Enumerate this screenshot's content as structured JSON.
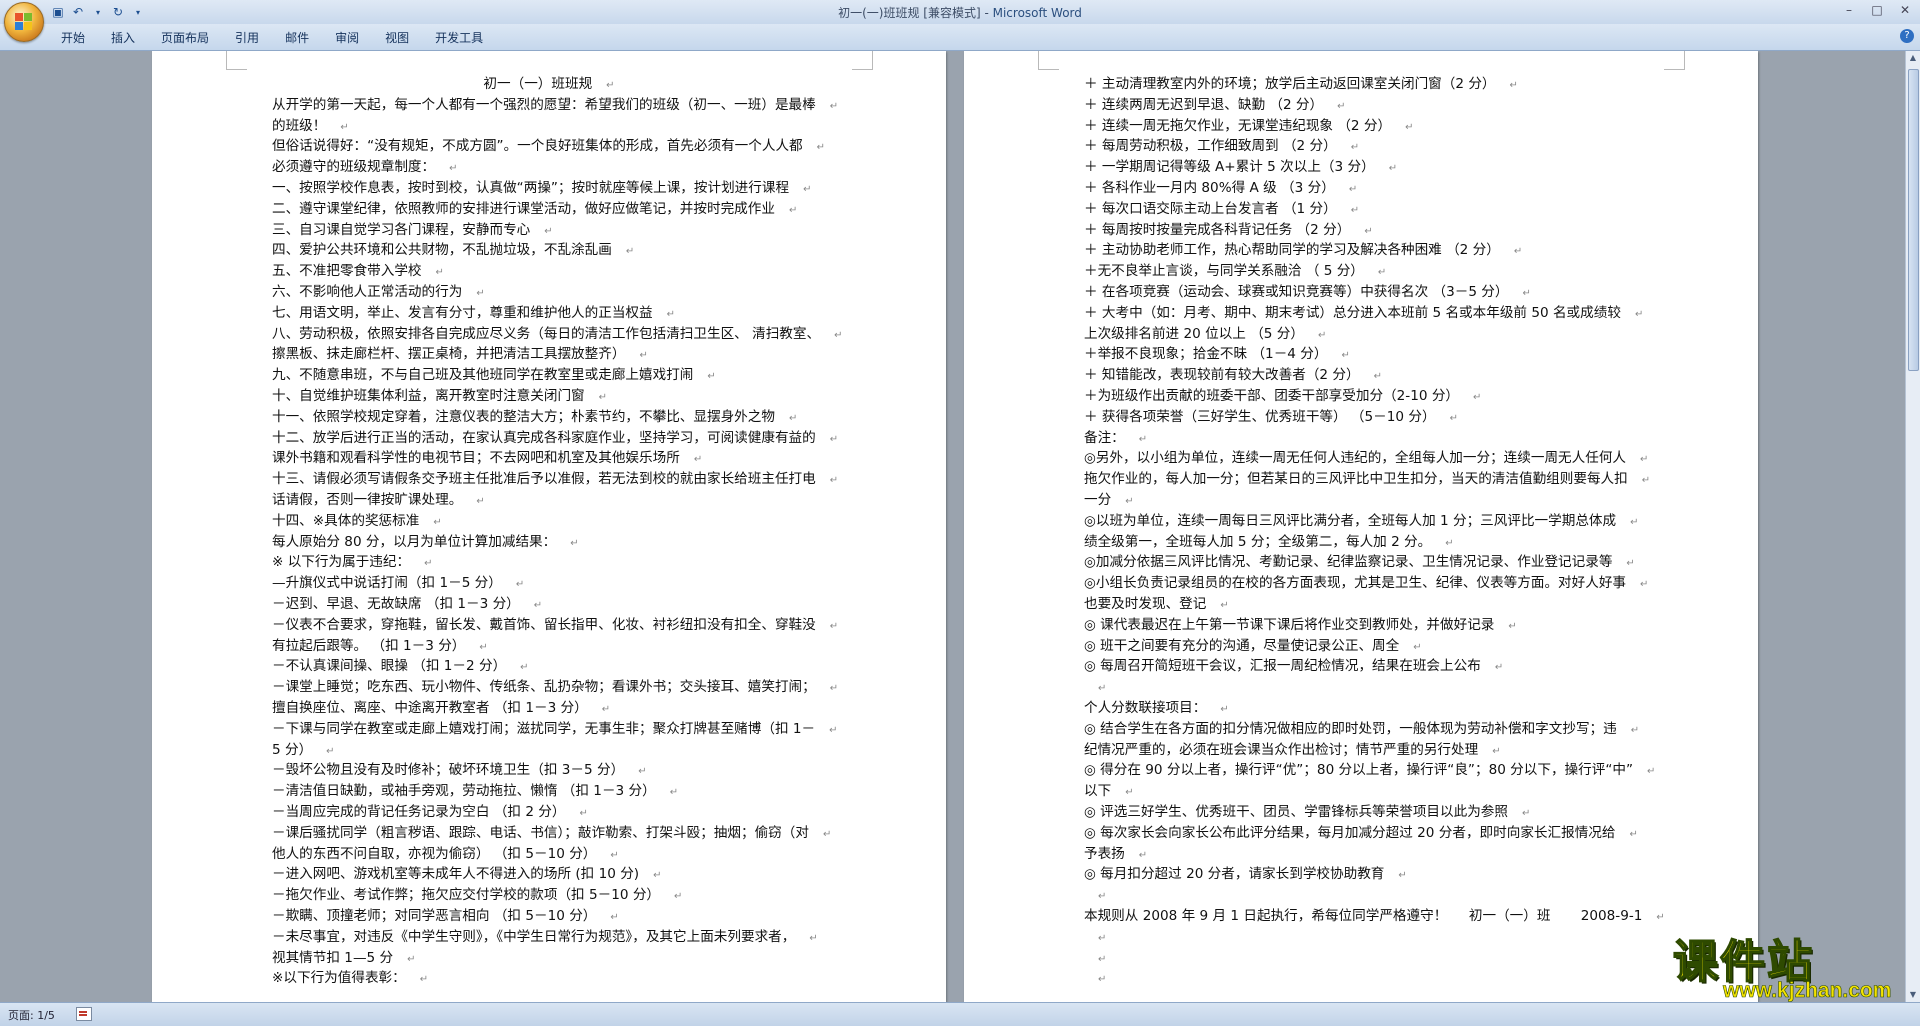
{
  "window": {
    "title": "初一(一)班班规 [兼容模式] - ",
    "app": "Microsoft Word"
  },
  "ribbon": {
    "tabs": [
      "开始",
      "插入",
      "页面布局",
      "引用",
      "邮件",
      "审阅",
      "视图",
      "开发工具"
    ]
  },
  "status": {
    "page": "页面: 1/5"
  },
  "watermark": {
    "text": "课件站",
    "url": "www.kjzhan.com"
  },
  "page1": {
    "lines": [
      "初一（一）班班规",
      "从开学的第一天起，每一个人都有一个强烈的愿望：希望我们的班级（初一、一班）是最棒",
      "的班级！",
      "但俗话说得好：“没有规矩，不成方圆”。一个良好班集体的形成，首先必须有一个人人都",
      "必须遵守的班级规章制度：",
      "一、按照学校作息表，按时到校，认真做“两操”；按时就座等候上课，按计划进行课程",
      "二、遵守课堂纪律，依照教师的安排进行课堂活动，做好应做笔记，并按时完成作业",
      "三、自习课自觉学习各门课程，安静而专心",
      "四、爱护公共环境和公共财物，不乱抛垃圾，不乱涂乱画",
      "五、不准把零食带入学校",
      "六、不影响他人正常活动的行为",
      "七、用语文明，举止、发言有分寸，尊重和维护他人的正当权益",
      "八、劳动积极，依照安排各自完成应尽义务（每日的清洁工作包括清扫卫生区、 清扫教室、",
      "擦黑板、抹走廊栏杆、摆正桌椅，并把清洁工具摆放整齐）",
      "九、不随意串班，不与自己班及其他班同学在教室里或走廊上嬉戏打闹",
      "十、自觉维护班集体利益，离开教室时注意关闭门窗",
      "十一、依照学校规定穿着，注意仪表的整洁大方；朴素节约，不攀比、显摆身外之物",
      "十二、放学后进行正当的活动，在家认真完成各科家庭作业，坚持学习，可阅读健康有益的",
      "课外书籍和观看科学性的电视节目；不去网吧和机室及其他娱乐场所",
      "十三、请假必须写请假条交予班主任批准后予以准假，若无法到校的就由家长给班主任打电",
      "话请假，否则一律按旷课处理。",
      "十四、※具体的奖惩标准",
      "每人原始分 80 分，以月为单位计算加减结果：",
      "※ 以下行为属于违纪：",
      "—升旗仪式中说话打闹（扣 1－5 分）",
      "－迟到、早退、无故缺席 （扣 1－3 分）",
      "－仪表不合要求，穿拖鞋，留长发、戴首饰、留长指甲、化妆、衬衫纽扣没有扣全、穿鞋没",
      "有拉起后跟等。 （扣 1－3 分）",
      "－不认真课间操、眼操 （扣 1－2 分）",
      "－课堂上睡觉；吃东西、玩小物件、传纸条、乱扔杂物；看课外书；交头接耳、嬉笑打闹；",
      "擅自换座位、离座、中途离开教室者 （扣 1－3 分）",
      "－下课与同学在教室或走廊上嬉戏打闹；滋扰同学，无事生非；聚众打牌甚至赌博（扣 1－",
      "5 分）",
      "－毁坏公物且没有及时修补；破坏环境卫生（扣 3－5 分）",
      "－清洁值日缺勤，或袖手旁观，劳动拖拉、懒惰 （扣 1－3 分）",
      "－当周应完成的背记任务记录为空白 （扣 2 分）",
      "－课后骚扰同学（粗言秽语、跟踪、电话、书信）；敲诈勒索、打架斗殴；抽烟；偷窃（对",
      "他人的东西不问自取，亦视为偷窃） （扣 5－10 分）",
      "－进入网吧、游戏机室等未成年人不得进入的场所 (扣 10 分)",
      "－拖欠作业、考试作弊；拖欠应交付学校的款项（扣 5－10 分）",
      "－欺瞒、顶撞老师；对同学恶言相向 （扣 5－10 分）",
      "－未尽事宜，对违反《中学生守则》，《中学生日常行为规范》，及其它上面未列要求者，",
      "视其情节扣 1—5 分",
      "※以下行为值得表彰："
    ]
  },
  "page2": {
    "lines": [
      "＋ 主动清理教室内外的环境；放学后主动返回课室关闭门窗（2 分）",
      "＋ 连续两周无迟到早退、缺勤 （2 分）",
      "＋ 连续一周无拖欠作业，无课堂违纪现象 （2 分）",
      "＋ 每周劳动积极，工作细致周到 （2 分）",
      "＋ 一学期周记得等级 A+累计 5 次以上（3 分）",
      "＋ 各科作业一月内 80%得 A 级 （3 分）",
      "＋ 每次口语交际主动上台发言者 （1 分）",
      "＋ 每周按时按量完成各科背记任务 （2 分）",
      "＋ 主动协助老师工作，热心帮助同学的学习及解决各种困难 （2 分）",
      "＋无不良举止言谈，与同学关系融洽 （ 5 分）",
      "＋ 在各项竞赛（运动会、球赛或知识竞赛等）中获得名次 （3－5 分）",
      "＋ 大考中（如：月考、期中、期末考试）总分进入本班前 5 名或本年级前 50 名或成绩较",
      "上次级排名前进 20 位以上 （5 分）",
      "＋举报不良现象；拾金不昧 （1－4 分）",
      "＋ 知错能改，表现较前有较大改善者（2 分）",
      "＋为班级作出贡献的班委干部、团委干部享受加分（2-10 分）",
      "＋ 获得各项荣誉（三好学生、优秀班干等） （5－10 分）",
      "备注：",
      "◎另外，以小组为单位，连续一周无任何人违纪的，全组每人加一分；连续一周无人任何人",
      "拖欠作业的，每人加一分；但若某日的三风评比中卫生扣分，当天的清洁值勤组则要每人扣",
      "一分",
      "◎以班为单位，连续一周每日三风评比满分者，全班每人加 1 分；三风评比一学期总体成",
      "绩全级第一，全班每人加 5 分；全级第二，每人加 2 分。",
      "◎加减分依据三风评比情况、考勤记录、纪律监察记录、卫生情况记录、作业登记记录等",
      "◎小组长负责记录组员的在校的各方面表现，尤其是卫生、纪律、仪表等方面。对好人好事",
      "也要及时发现、登记",
      "◎ 课代表最迟在上午第一节课下课后将作业交到教师处，并做好记录",
      "◎ 班干之间要有充分的沟通，尽量使记录公正、周全",
      "◎ 每周召开简短班干会议，汇报一周纪检情况，结果在班会上公布",
      "",
      "个人分数联接项目：",
      "◎ 结合学生在各方面的扣分情况做相应的即时处罚，一般体现为劳动补偿和字文抄写；违",
      "纪情况严重的，必须在班会课当众作出检讨；情节严重的另行处理",
      "◎ 得分在 90 分以上者，操行评“优”；80 分以上者，操行评“良”；80 分以下，操行评“中”",
      "以下",
      "◎ 评选三好学生、优秀班干、团员、学雷锋标兵等荣誉项目以此为参照",
      "◎ 每次家长会向家长公布此评分结果，每月加减分超过 20 分者，即时向家长汇报情况给",
      "予表扬",
      "◎ 每月扣分超过 20 分者，请家长到学校协助教育",
      "",
      "本规则从 2008 年 9 月 1 日起执行，希每位同学严格遵守！     初一（一）班       2008-9-1",
      "",
      "",
      ""
    ]
  }
}
